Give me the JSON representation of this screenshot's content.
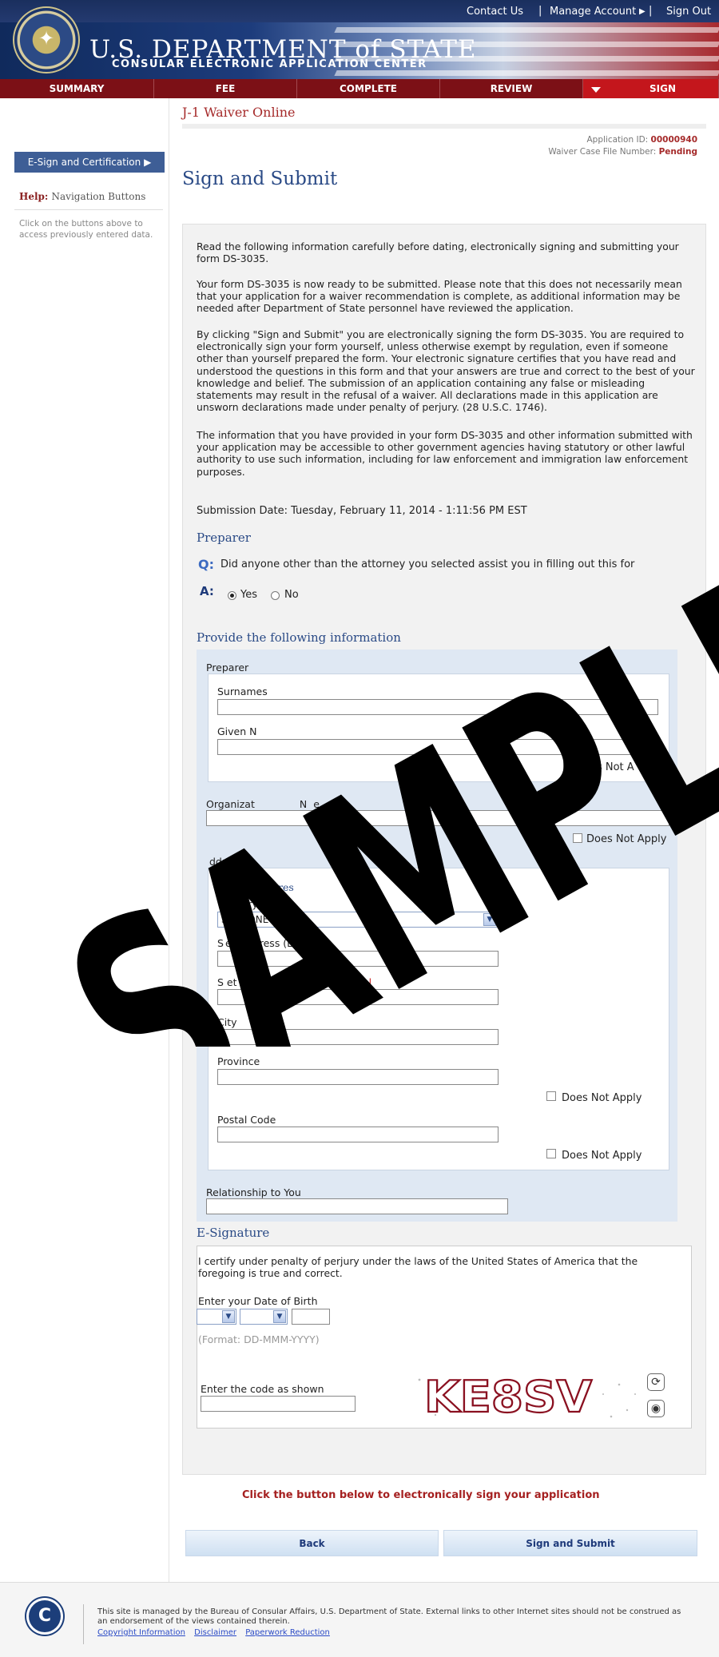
{
  "header": {
    "links": [
      "Contact Us",
      "Manage Account",
      "Sign Out"
    ],
    "dept_title": "U.S. DEPARTMENT of STATE",
    "dept_subtitle": "CONSULAR ELECTRONIC APPLICATION CENTER"
  },
  "nav": {
    "tabs": [
      "SUMMARY",
      "FEE",
      "COMPLETE",
      "REVIEW",
      "SIGN"
    ]
  },
  "sidebar": {
    "esign_label": "E-Sign and Certification",
    "help_title": "Help",
    "help_topic": "Navigation Buttons",
    "help_text": "Click on the buttons above to access previously entered data."
  },
  "app": {
    "title": "J-1 Waiver Online",
    "application_id_label": "Application ID:",
    "application_id": "00000940",
    "case_file_label": "Waiver Case File Number:",
    "case_file": "Pending",
    "page_title": "Sign and Submit"
  },
  "content": {
    "para1": "Read the following information carefully before dating, electronically signing and submitting your form DS-3035.",
    "para2": "Your form DS-3035 is now ready to be submitted. Please note that this does not necessarily mean that your application for a waiver recommendation is complete, as additional information may be needed after Department of State personnel have reviewed the application.",
    "para3": "By clicking \"Sign and Submit\" you are electronically signing the form DS-3035. You are required to electronically sign your form yourself, unless otherwise exempt by regulation, even if someone other than yourself prepared the form. Your electronic signature certifies that you have read and understood the questions in this form and that your answers are true and correct to the best of your knowledge and belief. The submission of an application containing any false or misleading statements may result in the refusal of a waiver. All declarations made in this application are unsworn declarations made under penalty of perjury. (28 U.S.C. 1746).",
    "para4": "The information that you have provided in your form DS-3035 and other information submitted with your application may be accessible to other government agencies having statutory or other lawful authority to use such information, including for law enforcement and immigration law enforcement purposes.",
    "submission": "Submission Date: Tuesday, February 11, 2014 - 1:11:56 PM EST"
  },
  "preparer": {
    "section_title": "Preparer",
    "q_label": "Q:",
    "question": "Did anyone other than the attorney you selected assist you in filling out this for",
    "a_label": "A:",
    "yes_label": "Yes",
    "no_label": "No",
    "selected": "Yes"
  },
  "info": {
    "section_title": "Provide the following information",
    "preparer_label": "Preparer",
    "surnames_label": "Surnames",
    "given_label": "Given N",
    "does_not_apply_1": "Does Not A",
    "org_label_a": "Organizat",
    "org_label_b": "N",
    "org_label_c": "e",
    "does_not_apply_2": "Does Not Apply",
    "address_label": "ddress",
    "current_address_label": "Current  ddres",
    "country_label": "ountry  egion",
    "country_value": "SELE   ONE -",
    "street1_label_a": "S",
    "street1_label_b": "eet A",
    "street1_label_c": "ress (L",
    "street1_label_d": "1)",
    "street2_label": "S  et Address (Line 2)",
    "optional_label": "*Optional",
    "city_label": "City",
    "province_label": "Province",
    "does_not_apply_3": "Does Not Apply",
    "postal_label": "Postal Code",
    "does_not_apply_4": "Does Not Apply",
    "relationship_label": "Relationship to You"
  },
  "esignature": {
    "section_title": "E-Signature",
    "certify": "I certify under penalty of perjury under the laws of the United States of America that the foregoing is true and correct.",
    "dob_label": "Enter your Date of Birth",
    "format_hint": "(Format: DD-MMM-YYYY)",
    "code_label": "Enter the code as shown",
    "captcha_text": "KE8SV"
  },
  "actions": {
    "click_note": "Click the button below to electronically sign your application",
    "back_label": "Back",
    "submit_label": "Sign and Submit"
  },
  "footer": {
    "text": "This site is managed by the Bureau of Consular Affairs, U.S. Department of State. External links to other Internet sites should not be construed as an endorsement of the views contained therein.",
    "links": [
      "Copyright Information",
      "Disclaimer",
      "Paperwork Reduction"
    ],
    "logo_letter": "C"
  },
  "watermark": {
    "text": "SAMPLE"
  },
  "colors": {
    "nav_bg": "#7c1016",
    "sign_tab": "#c4161c",
    "heading_blue": "#2a4a86",
    "accent_red": "#a52a2a"
  }
}
